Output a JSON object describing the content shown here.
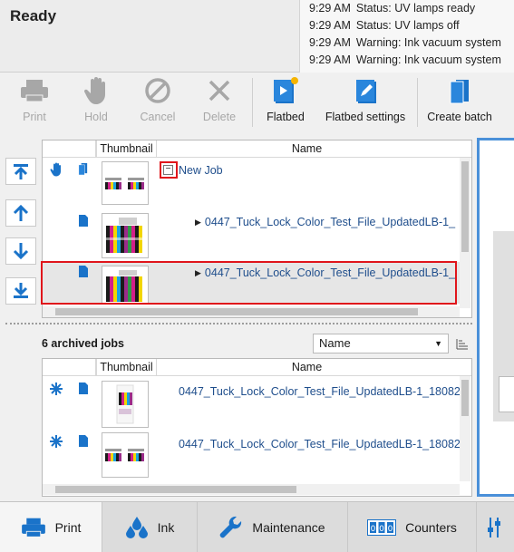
{
  "status": {
    "ready": "Ready"
  },
  "log": [
    {
      "time": "9:29 AM",
      "text": "Status: UV lamps ready"
    },
    {
      "time": "9:29 AM",
      "text": "Status: UV lamps off"
    },
    {
      "time": "9:29 AM",
      "text": "Warning: Ink vacuum system"
    },
    {
      "time": "9:29 AM",
      "text": "Warning: Ink vacuum system"
    }
  ],
  "toolbar": {
    "print": "Print",
    "hold": "Hold",
    "cancel": "Cancel",
    "delete": "Delete",
    "flatbed": "Flatbed",
    "flatbed_settings": "Flatbed settings",
    "create_batch": "Create batch"
  },
  "queue": {
    "headers": {
      "thumbnail": "Thumbnail",
      "name": "Name"
    },
    "group": {
      "toggle": "−",
      "name": "New Job"
    },
    "jobs": [
      {
        "name": "0447_Tuck_Lock_Color_Test_File_UpdatedLB-1_"
      },
      {
        "name": "0447_Tuck_Lock_Color_Test_File_UpdatedLB-1_"
      }
    ]
  },
  "archive": {
    "count_label": "6 archived jobs",
    "sort_value": "Name",
    "headers": {
      "thumbnail": "Thumbnail",
      "name": "Name"
    },
    "jobs": [
      {
        "name": "0447_Tuck_Lock_Color_Test_File_UpdatedLB-1_18082"
      },
      {
        "name": "0447_Tuck_Lock_Color_Test_File_UpdatedLB-1_18082"
      }
    ]
  },
  "tabs": {
    "print": "Print",
    "ink": "Ink",
    "maintenance": "Maintenance",
    "counters": "Counters"
  },
  "colors": {
    "accent_blue": "#1a73c9",
    "highlight_red": "#e0151b",
    "disabled_gray": "#a7a7a7"
  }
}
